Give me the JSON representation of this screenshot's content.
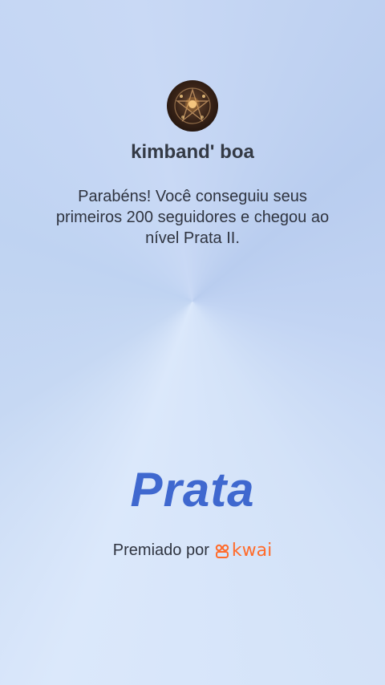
{
  "profile": {
    "username": "kimband' boa",
    "avatar_icon": "candle-pentagram-avatar"
  },
  "achievement": {
    "message": "Parabéns! Você conseguiu seus primeiros 200 seguidores e chegou ao nível Prata II.",
    "level_title": "Prata"
  },
  "footer": {
    "awarded_by": "Premiado por",
    "brand_name": "kwai",
    "brand_icon": "kwai-logo-icon",
    "brand_color": "#ff6b2b"
  },
  "colors": {
    "level_title": "#3f68cf",
    "text": "#2f3440"
  }
}
